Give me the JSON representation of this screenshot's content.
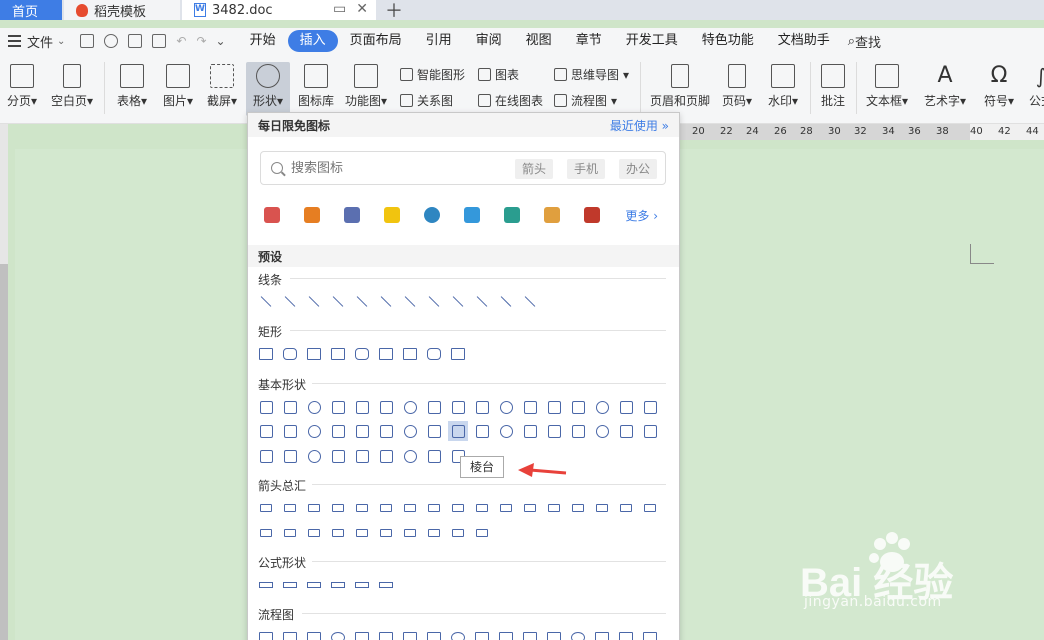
{
  "tabs": [
    {
      "label": "首页"
    },
    {
      "label": "稻壳模板"
    },
    {
      "label": "3482.doc"
    }
  ],
  "menu": {
    "file": "文件",
    "items": [
      "开始",
      "插入",
      "页面布局",
      "引用",
      "审阅",
      "视图",
      "章节",
      "开发工具",
      "特色功能",
      "文档助手"
    ],
    "active": "插入",
    "search": "查找"
  },
  "ribbon": {
    "buttons": [
      "分页",
      "空白页",
      "表格",
      "图片",
      "截屏",
      "形状",
      "图标库",
      "功能图"
    ],
    "small": [
      "智能图形",
      "图表",
      "思维导图",
      "关系图",
      "在线图表",
      "流程图"
    ],
    "right": [
      "页眉和页脚",
      "页码",
      "水印",
      "批注",
      "文本框",
      "艺术字",
      "符号",
      "公式"
    ]
  },
  "ruler": [
    "20",
    "22",
    "24",
    "26",
    "28",
    "30",
    "32",
    "34",
    "36",
    "38",
    "40",
    "42",
    "44"
  ],
  "panel": {
    "title": "每日限免图标",
    "recent": "最近使用",
    "search_placeholder": "搜索图标",
    "tags": [
      "箭头",
      "手机",
      "办公"
    ],
    "more": "更多",
    "preset": "预设",
    "sections": {
      "lines": "线条",
      "rect": "矩形",
      "basic": "基本形状",
      "arrows": "箭头总汇",
      "formula": "公式形状",
      "flow": "流程图"
    },
    "tooltip": "棱台"
  },
  "watermark": {
    "brand": "Bai 经验",
    "url": "jingyan.baidu.com"
  },
  "colors": {
    "accent": "#3e7de5",
    "doc_bg": "#d3e8cf",
    "arrow": "#e8413a"
  }
}
